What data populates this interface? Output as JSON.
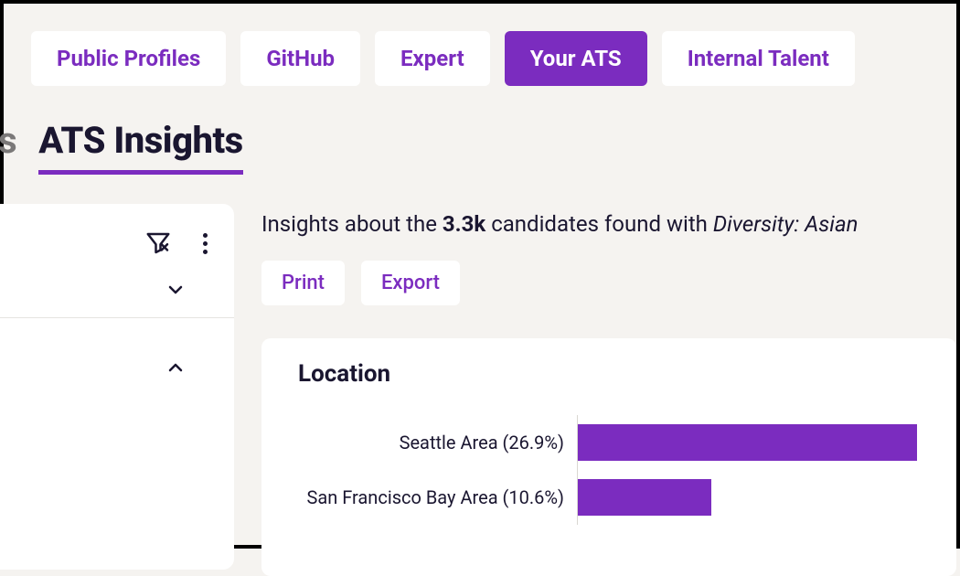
{
  "colors": {
    "accent": "#7b2cbf"
  },
  "tabs": [
    {
      "label": "Public Profiles",
      "active": false
    },
    {
      "label": "GitHub",
      "active": false
    },
    {
      "label": "Expert",
      "active": false
    },
    {
      "label": "Your ATS",
      "active": true
    },
    {
      "label": "Internal Talent",
      "active": false
    }
  ],
  "titles": {
    "prev_fragment": "tes",
    "current": "ATS Insights"
  },
  "insights": {
    "prefix": "Insights about the ",
    "count": "3.3k",
    "mid": " candidates found with ",
    "filter_label": "Diversity: Asian"
  },
  "actions": {
    "print": "Print",
    "export": "Export"
  },
  "chart_card": {
    "title": "Location"
  },
  "chart_data": {
    "type": "bar",
    "orientation": "horizontal",
    "title": "Location",
    "categories": [
      "Seattle Area",
      "San Francisco Bay Area"
    ],
    "values": [
      26.9,
      10.6
    ],
    "value_suffix": "%",
    "labels": [
      "Seattle Area (26.9%)",
      "San Francisco Bay Area (10.6%)"
    ],
    "xlim": [
      0,
      30
    ]
  }
}
